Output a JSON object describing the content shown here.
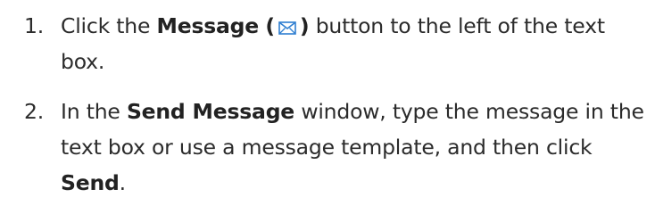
{
  "steps": [
    {
      "number": "1.",
      "text_before": "Click the ",
      "bold_label": "Message",
      "paren_open": "(",
      "icon": "envelope-icon",
      "paren_close": ")",
      "text_after": " button to the left of the text box."
    },
    {
      "number": "2.",
      "text_before": "In the ",
      "bold_label": "Send Message",
      "text_middle": " window, type the message in the text box or use a message template, and then click ",
      "bold_send": "Send",
      "text_end": "."
    }
  ],
  "colors": {
    "text": "#2b2b2b",
    "icon": "#2f7fd1"
  }
}
